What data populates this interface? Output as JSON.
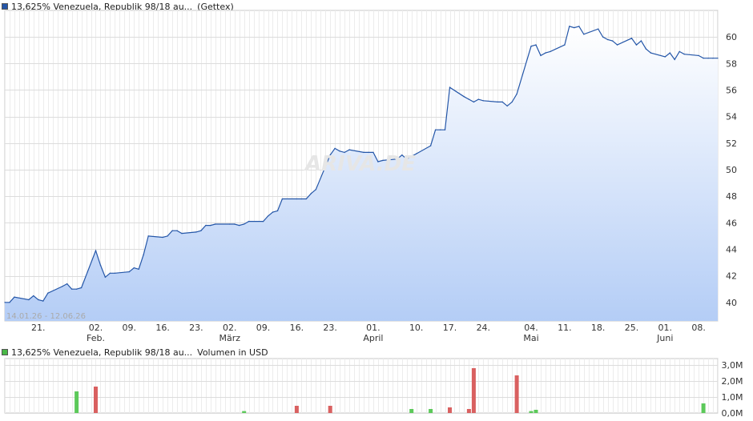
{
  "price_legend": {
    "color": "#2456a8",
    "label": "13,625% Venezuela, Republik 98/18 au...",
    "exchange": "(Gettex)"
  },
  "volume_legend": {
    "color": "#49b847",
    "label": "13,625% Venezuela, Republik 98/18 au...",
    "unit": "Volumen in USD"
  },
  "date_range": "14.01.26 - 12.06.26",
  "watermark": "ARIVA.DE",
  "chart_data": [
    {
      "type": "area",
      "title": "13,625% Venezuela, Republik 98/18 au... (Gettex)",
      "date_range": "14.01.26 - 12.06.26",
      "x_start": "2026-01-14",
      "x_end": "2026-06-12",
      "ylim": [
        38.6,
        62.0
      ],
      "yticks": [
        40,
        42,
        44,
        46,
        48,
        50,
        52,
        54,
        56,
        58,
        60
      ],
      "grid": true,
      "line_color": "#2456a8",
      "xticks": [
        {
          "day": "21.",
          "date": "2026-01-21"
        },
        {
          "day": "02.",
          "month": "Feb.",
          "date": "2026-02-02"
        },
        {
          "day": "09.",
          "date": "2026-02-09"
        },
        {
          "day": "16.",
          "date": "2026-02-16"
        },
        {
          "day": "23.",
          "date": "2026-02-23"
        },
        {
          "day": "02.",
          "month": "März",
          "date": "2026-03-02"
        },
        {
          "day": "09.",
          "date": "2026-03-09"
        },
        {
          "day": "16.",
          "date": "2026-03-16"
        },
        {
          "day": "23.",
          "date": "2026-03-23"
        },
        {
          "day": "01.",
          "month": "April",
          "date": "2026-04-01"
        },
        {
          "day": "10.",
          "date": "2026-04-10"
        },
        {
          "day": "17.",
          "date": "2026-04-17"
        },
        {
          "day": "24.",
          "date": "2026-04-24"
        },
        {
          "day": "04.",
          "month": "Mai",
          "date": "2026-05-04"
        },
        {
          "day": "11.",
          "date": "2026-05-11"
        },
        {
          "day": "18.",
          "date": "2026-05-18"
        },
        {
          "day": "25.",
          "date": "2026-05-25"
        },
        {
          "day": "01.",
          "month": "Juni",
          "date": "2026-06-01"
        },
        {
          "day": "08.",
          "date": "2026-06-08"
        }
      ],
      "series": [
        {
          "values": [
            [
              "2026-01-14",
              40.0
            ],
            [
              "2026-01-15",
              40.0
            ],
            [
              "2026-01-16",
              40.4
            ],
            [
              "2026-01-19",
              40.2
            ],
            [
              "2026-01-20",
              40.5
            ],
            [
              "2026-01-21",
              40.2
            ],
            [
              "2026-01-22",
              40.1
            ],
            [
              "2026-01-23",
              40.7
            ],
            [
              "2026-01-26",
              41.2
            ],
            [
              "2026-01-27",
              41.4
            ],
            [
              "2026-01-28",
              41.0
            ],
            [
              "2026-01-29",
              41.0
            ],
            [
              "2026-01-30",
              41.1
            ],
            [
              "2026-02-02",
              43.9
            ],
            [
              "2026-02-03",
              42.8
            ],
            [
              "2026-02-04",
              41.9
            ],
            [
              "2026-02-05",
              42.2
            ],
            [
              "2026-02-06",
              42.2
            ],
            [
              "2026-02-09",
              42.3
            ],
            [
              "2026-02-10",
              42.6
            ],
            [
              "2026-02-11",
              42.5
            ],
            [
              "2026-02-12",
              43.6
            ],
            [
              "2026-02-13",
              45.0
            ],
            [
              "2026-02-16",
              44.9
            ],
            [
              "2026-02-17",
              45.0
            ],
            [
              "2026-02-18",
              45.4
            ],
            [
              "2026-02-19",
              45.4
            ],
            [
              "2026-02-20",
              45.2
            ],
            [
              "2026-02-23",
              45.3
            ],
            [
              "2026-02-24",
              45.4
            ],
            [
              "2026-02-25",
              45.8
            ],
            [
              "2026-02-26",
              45.8
            ],
            [
              "2026-02-27",
              45.9
            ],
            [
              "2026-03-02",
              45.9
            ],
            [
              "2026-03-03",
              45.9
            ],
            [
              "2026-03-04",
              45.8
            ],
            [
              "2026-03-05",
              45.9
            ],
            [
              "2026-03-06",
              46.1
            ],
            [
              "2026-03-09",
              46.1
            ],
            [
              "2026-03-10",
              46.5
            ],
            [
              "2026-03-11",
              46.8
            ],
            [
              "2026-03-12",
              46.9
            ],
            [
              "2026-03-13",
              47.8
            ],
            [
              "2026-03-16",
              47.8
            ],
            [
              "2026-03-17",
              47.8
            ],
            [
              "2026-03-18",
              47.8
            ],
            [
              "2026-03-19",
              48.2
            ],
            [
              "2026-03-20",
              48.5
            ],
            [
              "2026-03-23",
              51.1
            ],
            [
              "2026-03-24",
              51.6
            ],
            [
              "2026-03-25",
              51.4
            ],
            [
              "2026-03-26",
              51.3
            ],
            [
              "2026-03-27",
              51.5
            ],
            [
              "2026-03-30",
              51.3
            ],
            [
              "2026-03-31",
              51.3
            ],
            [
              "2026-04-01",
              51.3
            ],
            [
              "2026-04-02",
              50.6
            ],
            [
              "2026-04-03",
              50.7
            ],
            [
              "2026-04-06",
              50.8
            ],
            [
              "2026-04-07",
              51.1
            ],
            [
              "2026-04-08",
              50.8
            ],
            [
              "2026-04-09",
              51.0
            ],
            [
              "2026-04-10",
              51.2
            ],
            [
              "2026-04-13",
              51.8
            ],
            [
              "2026-04-14",
              53.0
            ],
            [
              "2026-04-15",
              53.0
            ],
            [
              "2026-04-16",
              53.0
            ],
            [
              "2026-04-17",
              56.2
            ],
            [
              "2026-04-20",
              55.5
            ],
            [
              "2026-04-21",
              55.3
            ],
            [
              "2026-04-22",
              55.1
            ],
            [
              "2026-04-23",
              55.3
            ],
            [
              "2026-04-24",
              55.2
            ],
            [
              "2026-04-27",
              55.1
            ],
            [
              "2026-04-28",
              55.1
            ],
            [
              "2026-04-29",
              54.8
            ],
            [
              "2026-04-30",
              55.1
            ],
            [
              "2026-05-01",
              55.7
            ],
            [
              "2026-05-04",
              59.3
            ],
            [
              "2026-05-05",
              59.4
            ],
            [
              "2026-05-06",
              58.6
            ],
            [
              "2026-05-07",
              58.8
            ],
            [
              "2026-05-08",
              58.9
            ],
            [
              "2026-05-11",
              59.4
            ],
            [
              "2026-05-12",
              60.8
            ],
            [
              "2026-05-13",
              60.7
            ],
            [
              "2026-05-14",
              60.8
            ],
            [
              "2026-05-15",
              60.2
            ],
            [
              "2026-05-18",
              60.6
            ],
            [
              "2026-05-19",
              60.0
            ],
            [
              "2026-05-20",
              59.8
            ],
            [
              "2026-05-21",
              59.7
            ],
            [
              "2026-05-22",
              59.4
            ],
            [
              "2026-05-25",
              59.9
            ],
            [
              "2026-05-26",
              59.4
            ],
            [
              "2026-05-27",
              59.7
            ],
            [
              "2026-05-28",
              59.1
            ],
            [
              "2026-05-29",
              58.8
            ],
            [
              "2026-06-01",
              58.5
            ],
            [
              "2026-06-02",
              58.8
            ],
            [
              "2026-06-03",
              58.3
            ],
            [
              "2026-06-04",
              58.9
            ],
            [
              "2026-06-05",
              58.7
            ],
            [
              "2026-06-08",
              58.6
            ],
            [
              "2026-06-09",
              58.4
            ],
            [
              "2026-06-10",
              58.4
            ],
            [
              "2026-06-11",
              58.4
            ],
            [
              "2026-06-12",
              58.4
            ]
          ]
        }
      ]
    },
    {
      "type": "bar",
      "title": "13,625% Venezuela, Republik 98/18 au... Volumen in USD",
      "ylabel": "Volumen in USD",
      "ylim": [
        0,
        3.4
      ],
      "ytick_labels": [
        "3,0M",
        "2,0M",
        "1,0M",
        "0,0M"
      ],
      "yticks": [
        3.0,
        2.0,
        1.0,
        0.0
      ],
      "grid": true,
      "up_color": "#5cc95a",
      "down_color": "#d96060",
      "bars": [
        {
          "date": "2026-01-29",
          "value": 1.35,
          "dir": "up"
        },
        {
          "date": "2026-02-02",
          "value": 1.65,
          "dir": "down"
        },
        {
          "date": "2026-03-05",
          "value": 0.12,
          "dir": "up"
        },
        {
          "date": "2026-03-16",
          "value": 0.45,
          "dir": "down"
        },
        {
          "date": "2026-03-23",
          "value": 0.45,
          "dir": "down"
        },
        {
          "date": "2026-04-09",
          "value": 0.25,
          "dir": "up"
        },
        {
          "date": "2026-04-13",
          "value": 0.25,
          "dir": "up"
        },
        {
          "date": "2026-04-17",
          "value": 0.35,
          "dir": "down"
        },
        {
          "date": "2026-04-21",
          "value": 0.25,
          "dir": "down"
        },
        {
          "date": "2026-04-22",
          "value": 2.8,
          "dir": "down"
        },
        {
          "date": "2026-05-01",
          "value": 2.35,
          "dir": "down"
        },
        {
          "date": "2026-05-04",
          "value": 0.12,
          "dir": "up"
        },
        {
          "date": "2026-05-05",
          "value": 0.2,
          "dir": "up"
        },
        {
          "date": "2026-06-09",
          "value": 0.6,
          "dir": "up"
        }
      ]
    }
  ]
}
